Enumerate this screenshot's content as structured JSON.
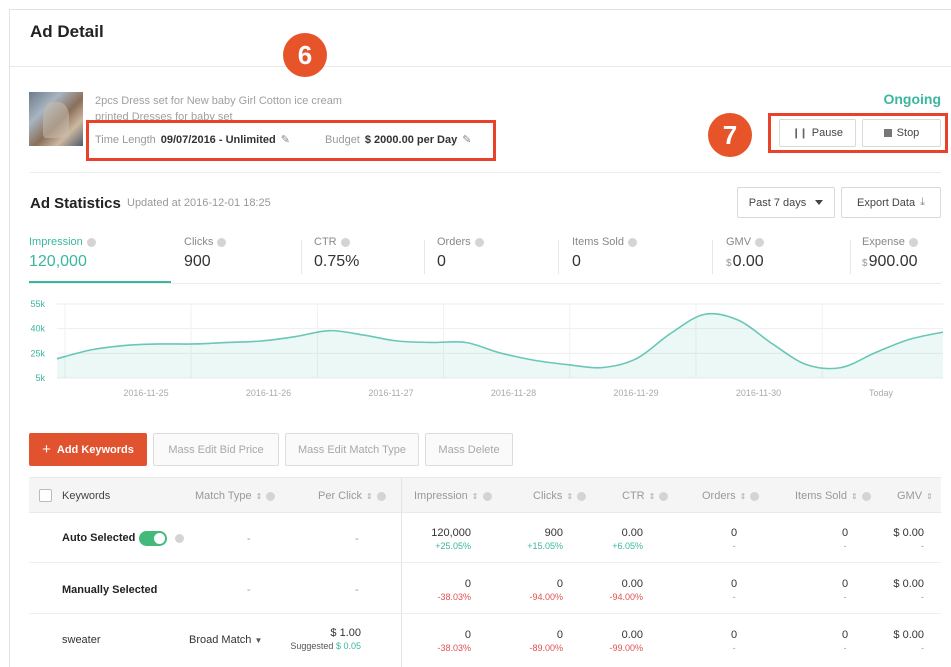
{
  "page": {
    "title": "Ad Detail"
  },
  "annotations": {
    "marker_6": "6",
    "marker_7": "7"
  },
  "ad": {
    "product_name": "2pcs Dress set for New baby Girl Cotton ice cream printed Dresses for baby set",
    "time_length_label": "Time Length",
    "time_length_value": "09/07/2016 - Unlimited",
    "budget_label": "Budget",
    "budget_value": "$ 2000.00 per Day",
    "status": "Ongoing",
    "pause_label": "Pause",
    "stop_label": "Stop"
  },
  "stats": {
    "title": "Ad Statistics",
    "updated": "Updated at 2016-12-01 18:25",
    "period_label": "Past 7 days",
    "export_label": "Export Data",
    "metrics": [
      {
        "label": "Impression",
        "value": "120,000",
        "currency": ""
      },
      {
        "label": "Clicks",
        "value": "900",
        "currency": ""
      },
      {
        "label": "CTR",
        "value": "0.75%",
        "currency": ""
      },
      {
        "label": "Orders",
        "value": "0",
        "currency": ""
      },
      {
        "label": "Items Sold",
        "value": "0",
        "currency": ""
      },
      {
        "label": "GMV",
        "value": "0.00",
        "currency": "$"
      },
      {
        "label": "Expense",
        "value": "900.00",
        "currency": "$"
      }
    ]
  },
  "chart_data": {
    "type": "area",
    "series": [
      {
        "values": [
          18,
          24,
          27,
          28,
          28,
          29,
          30,
          33,
          37,
          34,
          30,
          29,
          29,
          22,
          17,
          14,
          12,
          18,
          35,
          48,
          44,
          28,
          14,
          12,
          22,
          31,
          36
        ]
      }
    ],
    "x_tick_labels": [
      "2016-11-25",
      "2016-11-26",
      "2016-11-27",
      "2016-11-28",
      "2016-11-29",
      "2016-11-30",
      "Today"
    ],
    "y_tick_labels": [
      "55k",
      "40k",
      "25k",
      "5k"
    ],
    "ylim": [
      5,
      55
    ],
    "grid": true,
    "color": "#3bb6a0"
  },
  "toolbar": {
    "add_keywords": "Add Keywords",
    "mass_edit_bid": "Mass Edit Bid Price",
    "mass_edit_match": "Mass Edit Match Type",
    "mass_delete": "Mass Delete"
  },
  "table": {
    "headers": {
      "keywords": "Keywords",
      "match_type": "Match Type",
      "per_click": "Per Click",
      "impression": "Impression",
      "clicks": "Clicks",
      "ctr": "CTR",
      "orders": "Orders",
      "items_sold": "Items Sold",
      "gmv": "GMV"
    },
    "rows": [
      {
        "keyword": "Auto Selected",
        "match_type": "-",
        "per_click": "-",
        "suggested_label": "",
        "suggested_value": "",
        "impression": "120,000",
        "impression_delta": "+25.05%",
        "clicks": "900",
        "clicks_delta": "+15.05%",
        "ctr": "0.00",
        "ctr_delta": "+6.05%",
        "orders": "0",
        "orders_delta": "-",
        "items_sold": "0",
        "items_sold_delta": "-",
        "gmv": "$ 0.00",
        "gmv_delta": "-"
      },
      {
        "keyword": "Manually Selected",
        "match_type": "-",
        "per_click": "-",
        "suggested_label": "",
        "suggested_value": "",
        "impression": "0",
        "impression_delta": "-38.03%",
        "clicks": "0",
        "clicks_delta": "-94.00%",
        "ctr": "0.00",
        "ctr_delta": "-94.00%",
        "orders": "0",
        "orders_delta": "-",
        "items_sold": "0",
        "items_sold_delta": "-",
        "gmv": "$ 0.00",
        "gmv_delta": "-"
      },
      {
        "keyword": "sweater",
        "match_type": "Broad Match",
        "per_click": "$ 1.00",
        "suggested_label": "Suggested",
        "suggested_value": "$ 0.05",
        "impression": "0",
        "impression_delta": "-38.03%",
        "clicks": "0",
        "clicks_delta": "-89.00%",
        "ctr": "0.00",
        "ctr_delta": "-99.00%",
        "orders": "0",
        "orders_delta": "-",
        "items_sold": "0",
        "items_sold_delta": "-",
        "gmv": "$ 0.00",
        "gmv_delta": "-"
      }
    ]
  }
}
